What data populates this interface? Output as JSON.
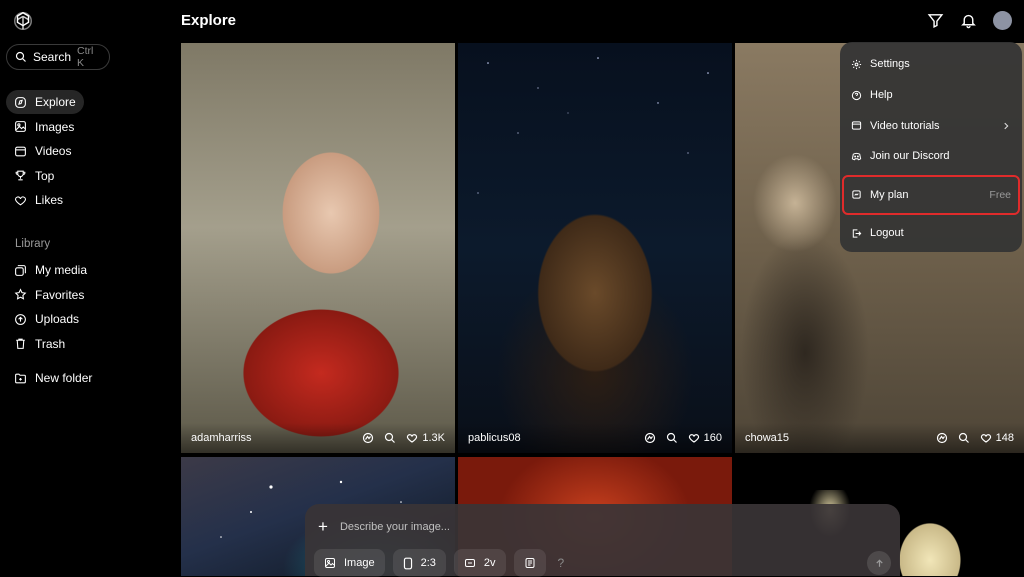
{
  "sidebar": {
    "search_label": "Search",
    "search_shortcut": "Ctrl K",
    "nav": [
      {
        "label": "Explore",
        "icon": "compass-icon"
      },
      {
        "label": "Images",
        "icon": "image-icon"
      },
      {
        "label": "Videos",
        "icon": "video-icon"
      },
      {
        "label": "Top",
        "icon": "trophy-icon"
      },
      {
        "label": "Likes",
        "icon": "heart-icon"
      }
    ],
    "library_heading": "Library",
    "library": [
      {
        "label": "My media"
      },
      {
        "label": "Favorites"
      },
      {
        "label": "Uploads"
      },
      {
        "label": "Trash"
      }
    ],
    "new_folder": "New folder"
  },
  "header": {
    "title": "Explore"
  },
  "cards": [
    {
      "user": "adamharriss",
      "likes": "1.3K"
    },
    {
      "user": "pablicus08",
      "likes": "160"
    },
    {
      "user": "chowa15",
      "likes": "148"
    }
  ],
  "menu": {
    "items": [
      {
        "label": "Settings",
        "icon": "gear-icon"
      },
      {
        "label": "Help",
        "icon": "help-icon"
      },
      {
        "label": "Video tutorials",
        "icon": "video-icon"
      },
      {
        "label": "Join our Discord",
        "icon": "discord-icon"
      },
      {
        "label": "My plan",
        "icon": "plan-icon",
        "badge": "Free"
      },
      {
        "label": "Logout",
        "icon": "logout-icon"
      }
    ]
  },
  "prompt": {
    "placeholder": "Describe your image...",
    "type_label": "Image",
    "ratio_label": "2:3",
    "version_label": "2v",
    "help_label": "?"
  },
  "colors": {
    "highlight": "#e02b2b",
    "background": "#000000"
  }
}
